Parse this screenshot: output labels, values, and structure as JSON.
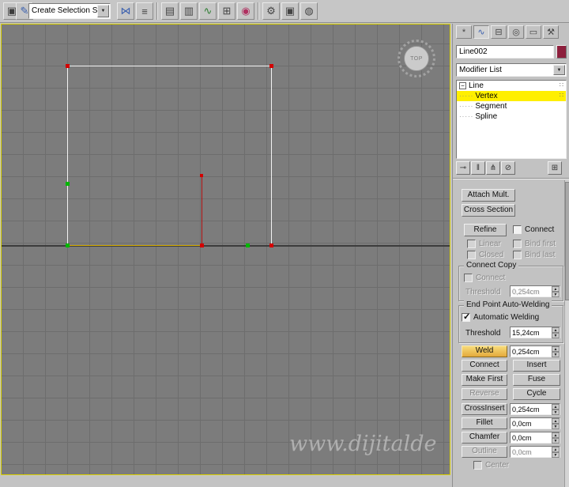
{
  "glyphs": {
    "dropdown_arrow": "▼",
    "spinner_up": "▲",
    "spinner_down": "▼",
    "substack": "∷",
    "expand": "−",
    "dots": "·····"
  },
  "toolbar": {
    "selection_set_value": "Create Selection Se",
    "icons": [
      {
        "name": "named-selections-icon",
        "glyph": "▣"
      },
      {
        "name": "edit-selections-icon",
        "glyph": "✎"
      },
      {
        "name": "mirror-icon",
        "glyph": "⋈"
      },
      {
        "name": "align-icon",
        "glyph": "≡"
      },
      {
        "name": "layer-manager-icon",
        "glyph": "▤"
      },
      {
        "name": "layer-list-icon",
        "glyph": "▥"
      },
      {
        "name": "curve-editor-icon",
        "glyph": "∿"
      },
      {
        "name": "schematic-view-icon",
        "glyph": "⊞"
      },
      {
        "name": "material-editor-icon",
        "glyph": "◉"
      },
      {
        "name": "render-setup-icon",
        "glyph": "⚙"
      },
      {
        "name": "rendered-frame-icon",
        "glyph": "▣"
      },
      {
        "name": "render-production-icon",
        "glyph": "◍"
      }
    ]
  },
  "viewport": {
    "view_label": "TOP",
    "watermark": "www.dijitalde"
  },
  "command_panel": {
    "tabs": [
      {
        "name": "create",
        "glyph": "*"
      },
      {
        "name": "modify",
        "glyph": "∿"
      },
      {
        "name": "hierarchy",
        "glyph": "⊟"
      },
      {
        "name": "motion",
        "glyph": "◎"
      },
      {
        "name": "display",
        "glyph": "▭"
      },
      {
        "name": "utilities",
        "glyph": "⚒"
      }
    ],
    "object_name": "Line002",
    "modifier_list_label": "Modifier List",
    "stack_root": "Line",
    "stack_children": [
      "Vertex",
      "Segment",
      "Spline"
    ],
    "stack_tools": [
      {
        "name": "pin-stack-icon",
        "glyph": "⊸"
      },
      {
        "name": "show-end-result-icon",
        "glyph": "‖"
      },
      {
        "name": "make-unique-icon",
        "glyph": "⋔"
      },
      {
        "name": "remove-modifier-icon",
        "glyph": "⊘"
      },
      {
        "name": "configure-modifier-sets-icon",
        "glyph": "⊞"
      }
    ]
  },
  "rollout": {
    "attach_mult_label": "Attach Mult.",
    "cross_section_label": "Cross Section",
    "refine_label": "Refine",
    "connect_checkbox_label": "Connect",
    "linear_label": "Linear",
    "bind_first_label": "Bind first",
    "closed_label": "Closed",
    "bind_last_label": "Bind last",
    "connect_copy_title": "Connect Copy",
    "connect_copy_checkbox_label": "Connect",
    "connect_copy_threshold_label": "Threshold",
    "connect_copy_threshold_value": "0,254cm",
    "end_point_title": "End Point Auto-Welding",
    "automatic_welding_label": "Automatic Welding",
    "weld_threshold_label": "Threshold",
    "weld_threshold_value": "15,24cm",
    "weld_label": "Weld",
    "weld_value": "0,254cm",
    "connect_button_label": "Connect",
    "insert_label": "Insert",
    "make_first_label": "Make First",
    "fuse_label": "Fuse",
    "reverse_label": "Reverse",
    "cycle_label": "Cycle",
    "cross_insert_label": "CrossInsert",
    "cross_insert_value": "0,254cm",
    "fillet_label": "Fillet",
    "fillet_value": "0,0cm",
    "chamfer_label": "Chamfer",
    "chamfer_value": "0,0cm",
    "outline_label": "Outline",
    "outline_value": "0,0cm",
    "center_label": "Center"
  },
  "colors": {
    "active_viewport_border": "#dbd200",
    "object_color_swatch": "#8d1f3c",
    "stack_selected_row": "#ffef00",
    "weld_button_highlight": "#e8b33c"
  }
}
